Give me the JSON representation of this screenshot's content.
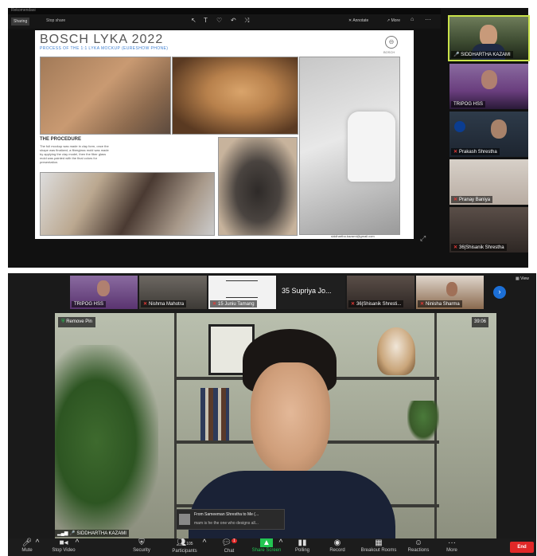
{
  "top_window": {
    "title_strip": "Rekomendasi",
    "toolbar": {
      "left_tag": "Sharing",
      "left_action": "Stop share",
      "annotate": "Annotate",
      "more": "More"
    }
  },
  "slide": {
    "title": "BOSCH LYKA 2022",
    "subtitle": "PROCESS OF THE 1:1 LYKA MOCKUP (EURESHOW PHONE)",
    "brand": "BOSCH",
    "section_heading": "THE PROCEDURE",
    "body_text": "The full mockup was made in clay form, once the shape was finalized, a fiberglass mold was made by applying the clay model, then the fiber glass mold was painted with the final colors for presentation.",
    "footer_credit": "siddhartha.kazami@gmail.com"
  },
  "top_participants": [
    {
      "name": "SIDDHARTHA KAZAMI",
      "active": true
    },
    {
      "name": "TRIPOG HSS",
      "active": false
    },
    {
      "name": "Prakash Shrestha",
      "active": false
    },
    {
      "name": "Pranay Baniya",
      "active": false
    },
    {
      "name": "36|Shisanik Shrestha",
      "active": false
    }
  ],
  "bottom_strip": {
    "tiles": [
      {
        "name": "TRIPOG HSS"
      },
      {
        "name": "Nishma Mahotra"
      },
      {
        "name": "15 Juniu Tamang"
      },
      {
        "name": "35 Supriya Jo..."
      },
      {
        "name": "36|Shisanik Shresti..."
      },
      {
        "name": "Ninisha Sharma"
      }
    ],
    "view_label": "View"
  },
  "speaker": {
    "remove_pin": "Remove Pin",
    "timer": "39:06",
    "name": "SIDDHARTHA KAZAMI"
  },
  "chat_popup": {
    "header": "From Sameeman Shrestha to Me (...",
    "message": "mam is he the one who designs all..."
  },
  "controls": [
    {
      "label": "Mute",
      "icon": "mic-icon"
    },
    {
      "label": "Stop Video",
      "icon": "video-icon"
    },
    {
      "label": "Security",
      "icon": "shield-icon"
    },
    {
      "label": "Participants",
      "icon": "participants-icon",
      "count": "105"
    },
    {
      "label": "Chat",
      "icon": "chat-icon",
      "badge": "1"
    },
    {
      "label": "Share Screen",
      "icon": "share-screen-icon"
    },
    {
      "label": "Polling",
      "icon": "polling-icon"
    },
    {
      "label": "Record",
      "icon": "record-icon"
    },
    {
      "label": "Breakout Rooms",
      "icon": "breakout-icon"
    },
    {
      "label": "Reactions",
      "icon": "reactions-icon"
    },
    {
      "label": "More",
      "icon": "more-icon"
    }
  ],
  "end_button": "End",
  "colors": {
    "dark_bg": "#1a1a1a",
    "control_bar": "#1c1c1c",
    "active_border": "#c9e24a",
    "share_green": "#23c552",
    "end_red": "#e02828",
    "slide_blue": "#3d7fd1",
    "view_blue": "#1c6fd6"
  }
}
